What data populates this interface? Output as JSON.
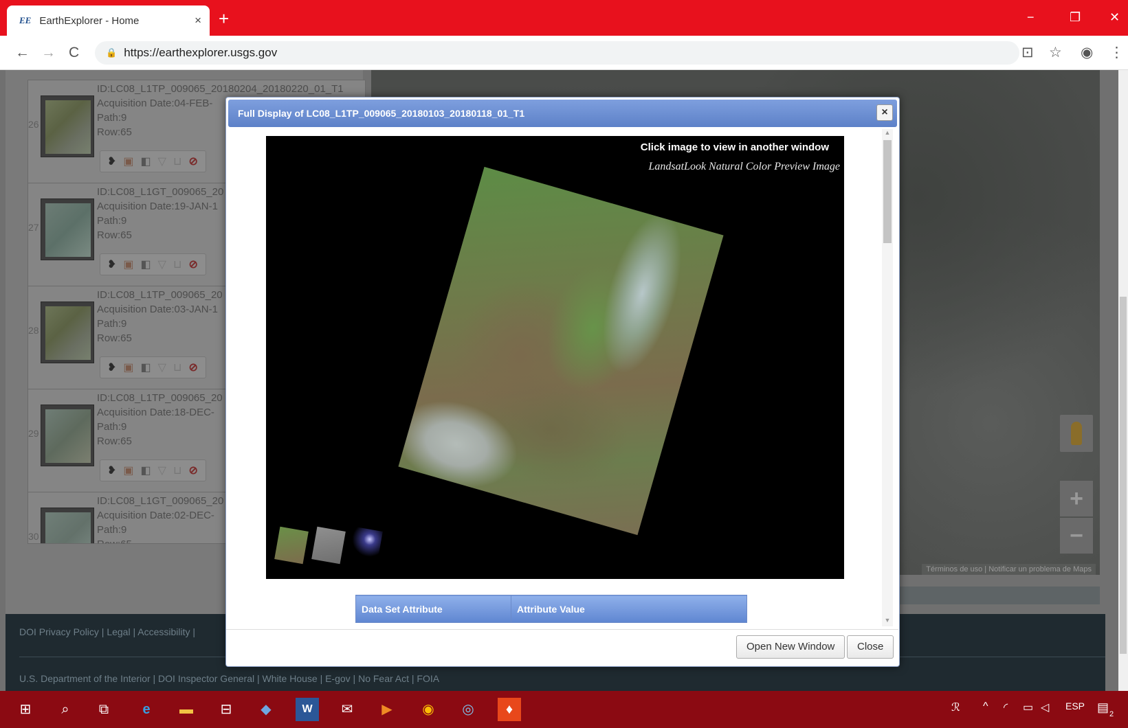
{
  "browser": {
    "tab_title": "EarthExplorer - Home",
    "tab_favicon": "EE",
    "tab_close": "×",
    "new_tab": "+",
    "url": "https://earthexplorer.usgs.gov",
    "window_controls": {
      "minimize": "−",
      "maximize": "❐",
      "close": "✕"
    },
    "nav": {
      "back": "←",
      "forward": "→",
      "reload": "C"
    },
    "toolbar_icons": {
      "translate": "⊡",
      "star": "☆",
      "account": "◉",
      "menu": "⋮"
    }
  },
  "results": [
    {
      "number": "26",
      "id": "ID:LC08_L1TP_009065_20180204_20180220_01_T1",
      "acq": "Acquisition Date:04-FEB-",
      "path": "Path:9",
      "row": "Row:65"
    },
    {
      "number": "27",
      "id": "ID:LC08_L1GT_009065_20",
      "acq": "Acquisition Date:19-JAN-1",
      "path": "Path:9",
      "row": "Row:65"
    },
    {
      "number": "28",
      "id": "ID:LC08_L1TP_009065_20",
      "acq": "Acquisition Date:03-JAN-1",
      "path": "Path:9",
      "row": "Row:65"
    },
    {
      "number": "29",
      "id": "ID:LC08_L1TP_009065_20",
      "acq": "Acquisition Date:18-DEC-",
      "path": "Path:9",
      "row": "Row:65"
    },
    {
      "number": "30",
      "id": "ID:LC08_L1GT_009065_20",
      "acq": "Acquisition Date:02-DEC-",
      "path": "Path:9",
      "row": "Row:65"
    }
  ],
  "result_actions": [
    "footprint-icon",
    "browse-icon",
    "metadata-icon",
    "bulk-download-icon",
    "cart-icon",
    "exclude-icon"
  ],
  "map": {
    "terms": "Términos de uso | Notificar un problema de Maps",
    "zoom_in": "+",
    "zoom_out": "−"
  },
  "footer": {
    "links_row1": "DOI Privacy Policy  |  Legal  |  Accessibility  |",
    "links_row2": "U.S. Department of the Interior  |  DOI Inspector General  |  White House  |  E-gov  |  No Fear Act  |  FOIA"
  },
  "dialog": {
    "title": "Full Display of LC08_L1TP_009065_20180103_20180118_01_T1",
    "close_icon": "×",
    "image_hint": "Click image to view in another window",
    "image_caption": "LandsatLook Natural Color Preview Image",
    "table_headers": [
      "Data Set Attribute",
      "Attribute Value"
    ],
    "buttons": {
      "open_new_window": "Open New Window",
      "close": "Close"
    }
  },
  "taskbar": {
    "tray_lang": "ESP",
    "notification_count": "2"
  }
}
